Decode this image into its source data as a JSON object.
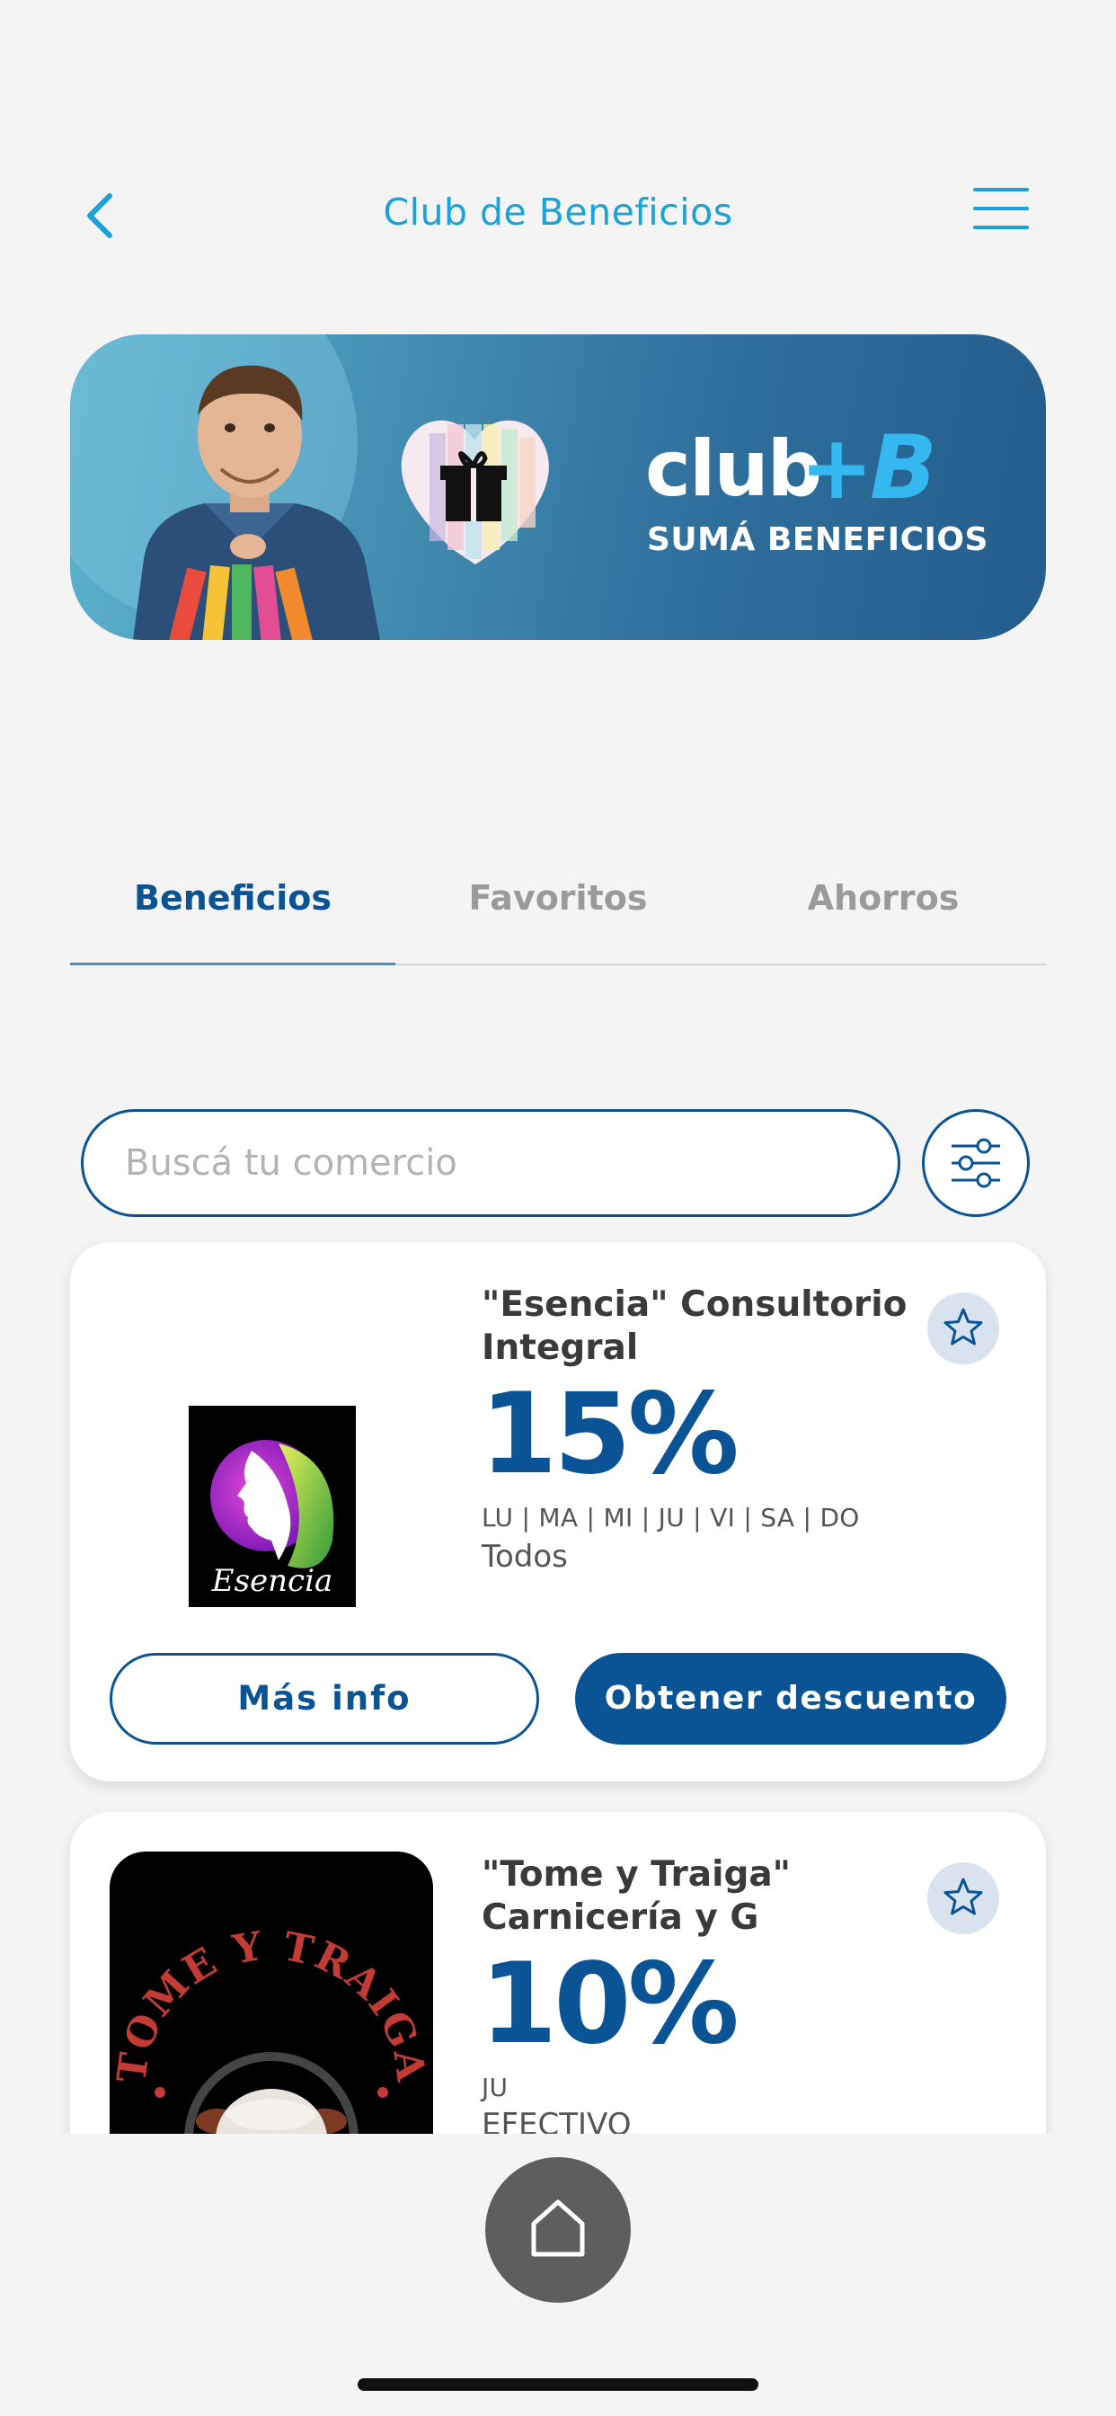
{
  "header": {
    "title": "Club de Beneficios",
    "back_icon": "chevron-left-icon",
    "menu_icon": "hamburger-menu-icon"
  },
  "banner": {
    "brand": "club",
    "brand_accent": "+B",
    "tagline": "SUMÁ BENEFICIOS"
  },
  "tabs": [
    {
      "label": "Beneficios",
      "active": true
    },
    {
      "label": "Favoritos",
      "active": false
    },
    {
      "label": "Ahorros",
      "active": false
    }
  ],
  "search": {
    "placeholder": "Buscá tu comercio",
    "value": "",
    "filter_icon": "sliders-icon"
  },
  "merchants": [
    {
      "name": "\"Esencia\" Consultorio Integral",
      "discount": "15%",
      "days": "LU | MA | MI | JU | VI | SA | DO",
      "condition": "Todos",
      "logo_text": "Esencia",
      "favorite_icon": "star-outline-icon",
      "more_info_label": "Más info",
      "get_discount_label": "Obtener descuento"
    },
    {
      "name": "\"Tome y Traiga\" Carnicería y G",
      "discount": "10%",
      "days": "JU",
      "condition": "EFECTIVO",
      "logo_text": "TOME Y TRAIGA",
      "favorite_icon": "star-outline-icon"
    }
  ],
  "bottom_nav": {
    "home_icon": "home-icon"
  },
  "colors": {
    "primary": "#0a5394",
    "accent": "#1aa3d9",
    "background": "#f4f4f4",
    "inactive_tab": "#9a9a9a"
  }
}
